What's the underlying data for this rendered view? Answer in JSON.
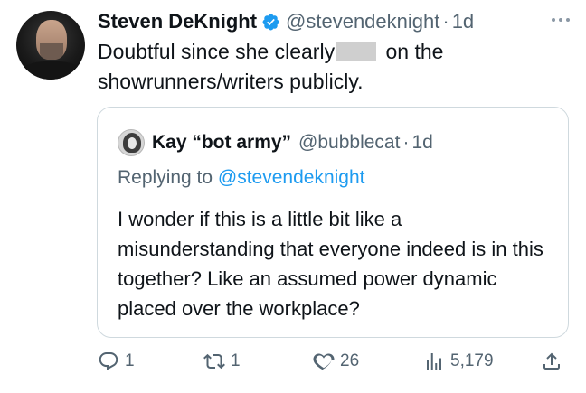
{
  "tweet": {
    "author_name": "Steven DeKnight",
    "handle": "@stevendeknight",
    "separator": "·",
    "time": "1d",
    "text_before_redaction": "Doubtful since she clearly",
    "text_after_redaction": " on the showrunners/writers publicly.",
    "verified_color": "#1d9bf0"
  },
  "quote": {
    "author_name": "Kay “bot army”",
    "handle": "@bubblecat",
    "separator": "·",
    "time": "1d",
    "replying_prefix": "Replying to ",
    "replying_handle": "@stevendeknight",
    "text": "I wonder if this is a little bit like a misunderstanding that everyone indeed is in this together? Like an assumed power dynamic placed over the workplace?"
  },
  "actions": {
    "replies": "1",
    "retweets": "1",
    "likes": "26",
    "views": "5,179",
    "icons": [
      "reply-icon",
      "retweet-icon",
      "like-icon",
      "views-icon",
      "share-icon"
    ]
  },
  "colors": {
    "text": "#0f1419",
    "secondary": "#536471",
    "link": "#1d9bf0",
    "border": "#cfd9de"
  }
}
